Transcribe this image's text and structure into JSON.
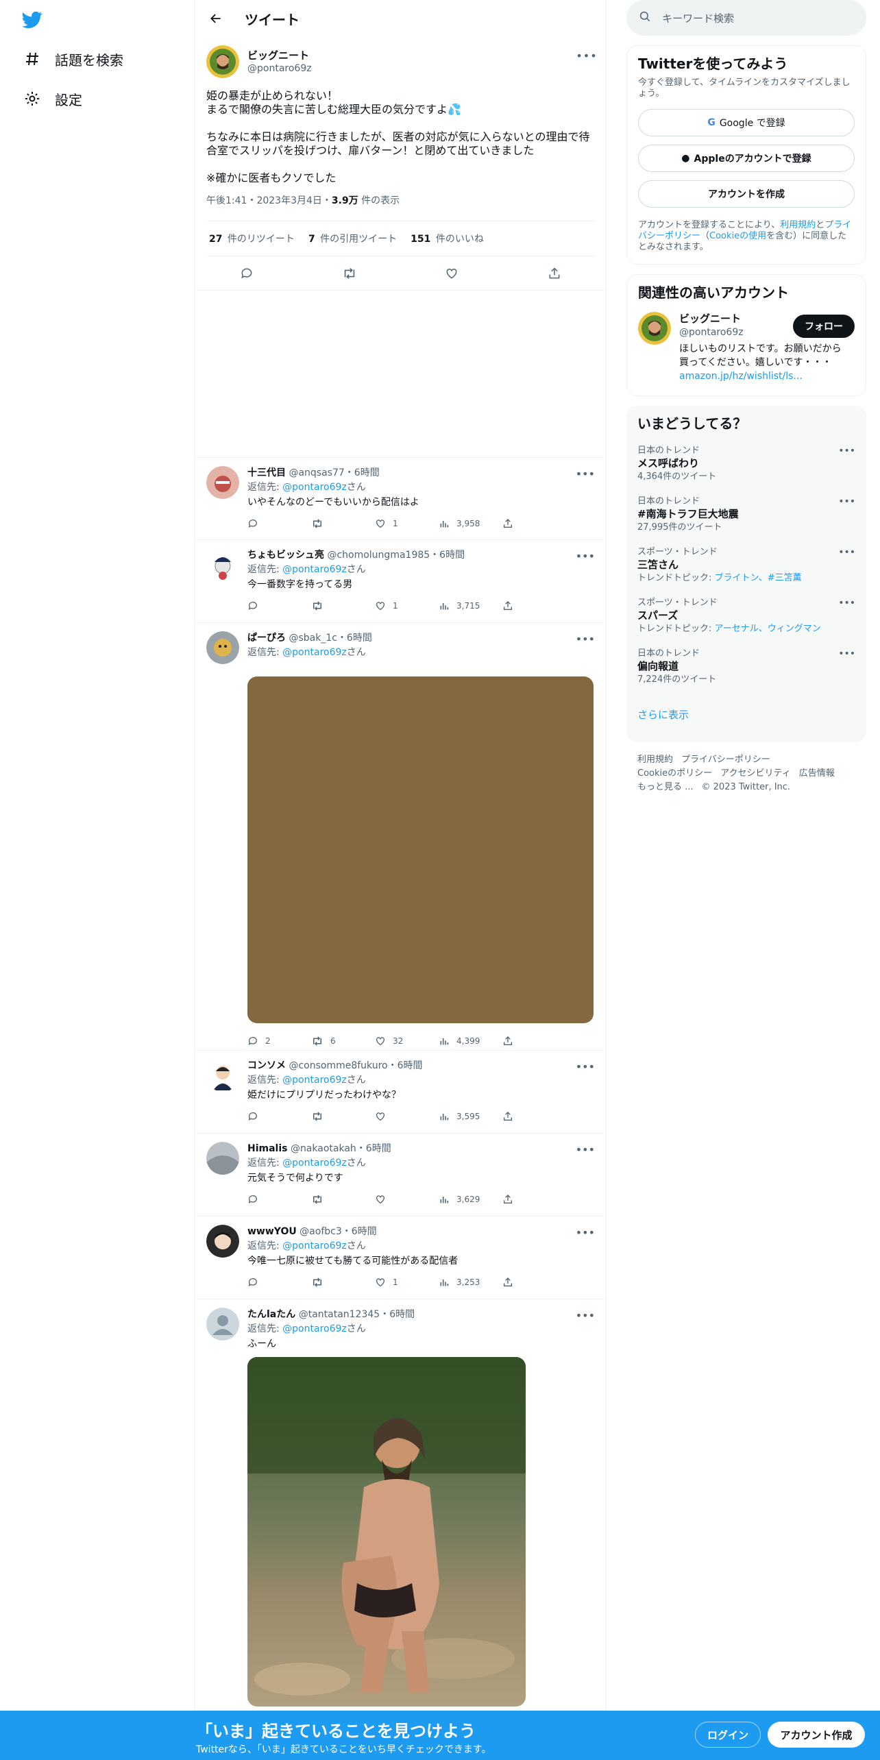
{
  "nav": {
    "items": [
      {
        "label": "話題を検索",
        "icon": "hashtag-icon"
      },
      {
        "label": "設定",
        "icon": "gear-icon"
      }
    ]
  },
  "header": {
    "title": "ツイート"
  },
  "main_tweet": {
    "name": "ビッグニート",
    "handle": "@pontaro69z",
    "text": "姫の暴走が止められない！\nまるで閣僚の失言に苦しむ総理大臣の気分ですよ💦\n\nちなみに本日は病院に行きましたが、医者の対応が気に入らないとの理由で待合室でスリッパを投げつけ、扉バターン！と閉めて出ていきました\n\n※確かに医者もクソでした",
    "time": "午後1:41・2023年3月4日・",
    "views_count": "3.9万",
    "views_label": " 件の表示",
    "retweets_count": "27",
    "retweets_label": " 件のリツイート",
    "quotes_count": "7",
    "quotes_label": " 件の引用ツイート",
    "likes_count": "151",
    "likes_label": " 件のいいね"
  },
  "replies": [
    {
      "name": "十三代目",
      "handle": "@anqsas77",
      "time": "・6時間",
      "reply_prefix": "返信先: ",
      "reply_to": "@pontaro69z",
      "reply_suffix": "さん",
      "text": "いやそんなのどーでもいいから配信はよ",
      "replies": "",
      "retweets": "",
      "likes": "1",
      "views": "3,958"
    },
    {
      "name": "ちょもビッシュ亮",
      "handle": "@chomolungma1985",
      "time": "・6時間",
      "reply_prefix": "返信先: ",
      "reply_to": "@pontaro69z",
      "reply_suffix": "さん",
      "text": "今一番数字を持ってる男",
      "replies": "",
      "retweets": "",
      "likes": "1",
      "views": "3,715"
    },
    {
      "name": "ぱーぴろ",
      "handle": "@sbak_1c",
      "time": "・6時間",
      "reply_prefix": "返信先: ",
      "reply_to": "@pontaro69z",
      "reply_suffix": "さん",
      "text": "",
      "replies": "2",
      "retweets": "6",
      "likes": "32",
      "views": "4,399"
    },
    {
      "name": "コンソメ",
      "handle": "@consomme8fukuro",
      "time": "・6時間",
      "reply_prefix": "返信先: ",
      "reply_to": "@pontaro69z",
      "reply_suffix": "さん",
      "text": "姫だけにプリプリだったわけやな？",
      "replies": "",
      "retweets": "",
      "likes": "",
      "views": "3,595"
    },
    {
      "name": "Himalis",
      "handle": "@nakaotakah",
      "time": "・6時間",
      "reply_prefix": "返信先: ",
      "reply_to": "@pontaro69z",
      "reply_suffix": "さん",
      "text": "元気そうで何よりです",
      "replies": "",
      "retweets": "",
      "likes": "",
      "views": "3,629"
    },
    {
      "name": "wwwYOU",
      "handle": "@aofbc3",
      "time": "・6時間",
      "reply_prefix": "返信先: ",
      "reply_to": "@pontaro69z",
      "reply_suffix": "さん",
      "text": "今唯一七原に被せても勝てる可能性がある配信者",
      "replies": "",
      "retweets": "",
      "likes": "1",
      "views": "3,253"
    },
    {
      "name": "たんlaたん",
      "handle": "@tantatan12345",
      "time": "・6時間",
      "reply_prefix": "返信先: ",
      "reply_to": "@pontaro69z",
      "reply_suffix": "さん",
      "text": "ふーん",
      "replies": "",
      "retweets": "",
      "likes": "",
      "views": ""
    }
  ],
  "right": {
    "search_placeholder": "キーワード検索",
    "signup": {
      "title": "Twitterを使ってみよう",
      "subtitle": "今すぐ登録して、タイムラインをカスタマイズしましょう。",
      "google": "Google で登録",
      "apple": "Appleのアカウントで登録",
      "create": "アカウントを作成",
      "legal_1": "アカウントを登録することにより、",
      "legal_terms": "利用規約",
      "legal_2": "と",
      "legal_privacy": "プライバシーポリシー",
      "legal_3": "（",
      "legal_cookie": "Cookieの使用",
      "legal_4": "を含む）に同意したとみなされます。"
    },
    "related": {
      "title": "関連性の高いアカウント",
      "name": "ビッグニート",
      "handle": "@pontaro69z",
      "follow": "フォロー",
      "bio": "ほしいものリストです。お願いだから買ってください。嬉しいです・・・",
      "link": "amazon.jp/hz/wishlist/ls..."
    },
    "trends": {
      "title": "いまどうしてる？",
      "items": [
        {
          "context": "日本のトレンド",
          "name": "メス呼ばわり",
          "meta": "4,364件のツイート"
        },
        {
          "context": "日本のトレンド",
          "name": "#南海トラフ巨大地震",
          "meta": "27,995件のツイート"
        },
        {
          "context": "スポーツ・トレンド",
          "name": "三笘さん",
          "meta_prefix": "トレンドトピック: ",
          "meta_links": "ブライトン、#三笘薫"
        },
        {
          "context": "スポーツ・トレンド",
          "name": "スパーズ",
          "meta_prefix": "トレンドトピック: ",
          "meta_links": "アーセナル、ウィングマン"
        },
        {
          "context": "日本のトレンド",
          "name": "偏向報道",
          "meta": "7,224件のツイート"
        }
      ],
      "show_more": "さらに表示"
    },
    "footer": {
      "l1": "利用規約",
      "l2": "プライバシーポリシー",
      "l3": "Cookieのポリシー",
      "l4": "アクセシビリティ",
      "l5": "広告情報",
      "l6": "もっと見る ...",
      "l7": "© 2023 Twitter, Inc."
    }
  },
  "banner": {
    "title": "「いま」起きていることを見つけよう",
    "subtitle": "Twitterなら、「いま」起きていることをいち早くチェックできます。",
    "login": "ログイン",
    "signup": "アカウント作成"
  },
  "colors": {
    "accent": "#1d9bf0",
    "banner": "#1d9bf0",
    "media_placeholder": "#84693f"
  }
}
